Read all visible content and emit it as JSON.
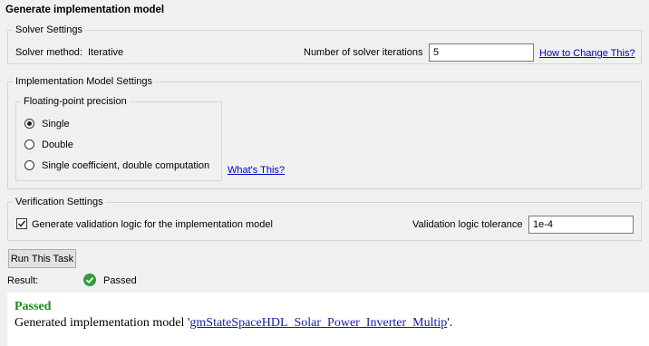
{
  "panel": {
    "title": "Generate implementation model"
  },
  "solver_settings": {
    "legend": "Solver Settings",
    "method_label": "Solver method:",
    "method_value": "Iterative",
    "iterations_label": "Number of solver iterations",
    "iterations_value": "5",
    "help_link": "How to Change This?"
  },
  "implementation_settings": {
    "legend": "Implementation Model Settings",
    "precision_legend": "Floating-point precision",
    "options": [
      {
        "label": "Single",
        "selected": true
      },
      {
        "label": "Double",
        "selected": false
      },
      {
        "label": "Single coefficient, double computation",
        "selected": false
      }
    ],
    "help_link": "What's This?"
  },
  "verification_settings": {
    "legend": "Verification Settings",
    "checkbox_label": "Generate validation logic for the implementation model",
    "checkbox_checked": true,
    "tolerance_label": "Validation logic tolerance",
    "tolerance_value": "1e-4"
  },
  "run_button": "Run This Task",
  "result": {
    "label": "Result:",
    "status": "Passed"
  },
  "report": {
    "status": "Passed",
    "message_prefix": "Generated implementation model '",
    "model_link": "gmStateSpaceHDL_Solar_Power_Inverter_Multip",
    "message_suffix": "'."
  }
}
